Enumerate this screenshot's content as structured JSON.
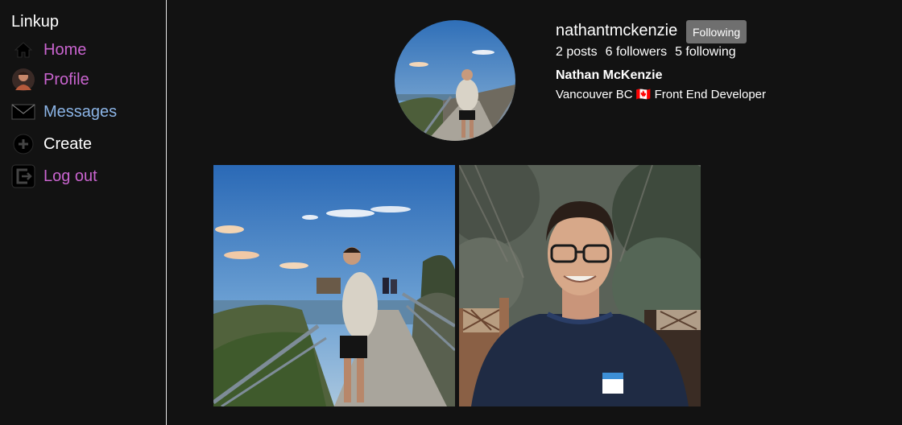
{
  "app": {
    "brand": "Linkup"
  },
  "sidebar": {
    "items": [
      {
        "label": "Home",
        "icon": "home-icon",
        "color": "#c964cf"
      },
      {
        "label": "Profile",
        "icon": "profile-avatar-icon",
        "color": "#c964cf"
      },
      {
        "label": "Messages",
        "icon": "envelope-icon",
        "color": "#8bb4e6"
      },
      {
        "label": "Create",
        "icon": "plus-circle-icon",
        "color": "#ffffff"
      },
      {
        "label": "Log out",
        "icon": "logout-icon",
        "color": "#c964cf"
      }
    ]
  },
  "profile": {
    "username": "nathantmckenzie",
    "follow_button": "Following",
    "posts": "2 posts",
    "followers": "6 followers",
    "following": "5 following",
    "full_name": "Nathan McKenzie",
    "bio": "Vancouver BC 🇨🇦 Front End Developer"
  },
  "posts": [
    {
      "kind": "photo",
      "subject": "man standing on coastal hiking trail railing"
    },
    {
      "kind": "photo",
      "subject": "smiling man with glasses in navy sweater"
    }
  ],
  "colors": {
    "background": "#121212",
    "accent_pink": "#c964cf",
    "accent_blue": "#8bb4e6",
    "button_gray": "#6f6f6f"
  }
}
